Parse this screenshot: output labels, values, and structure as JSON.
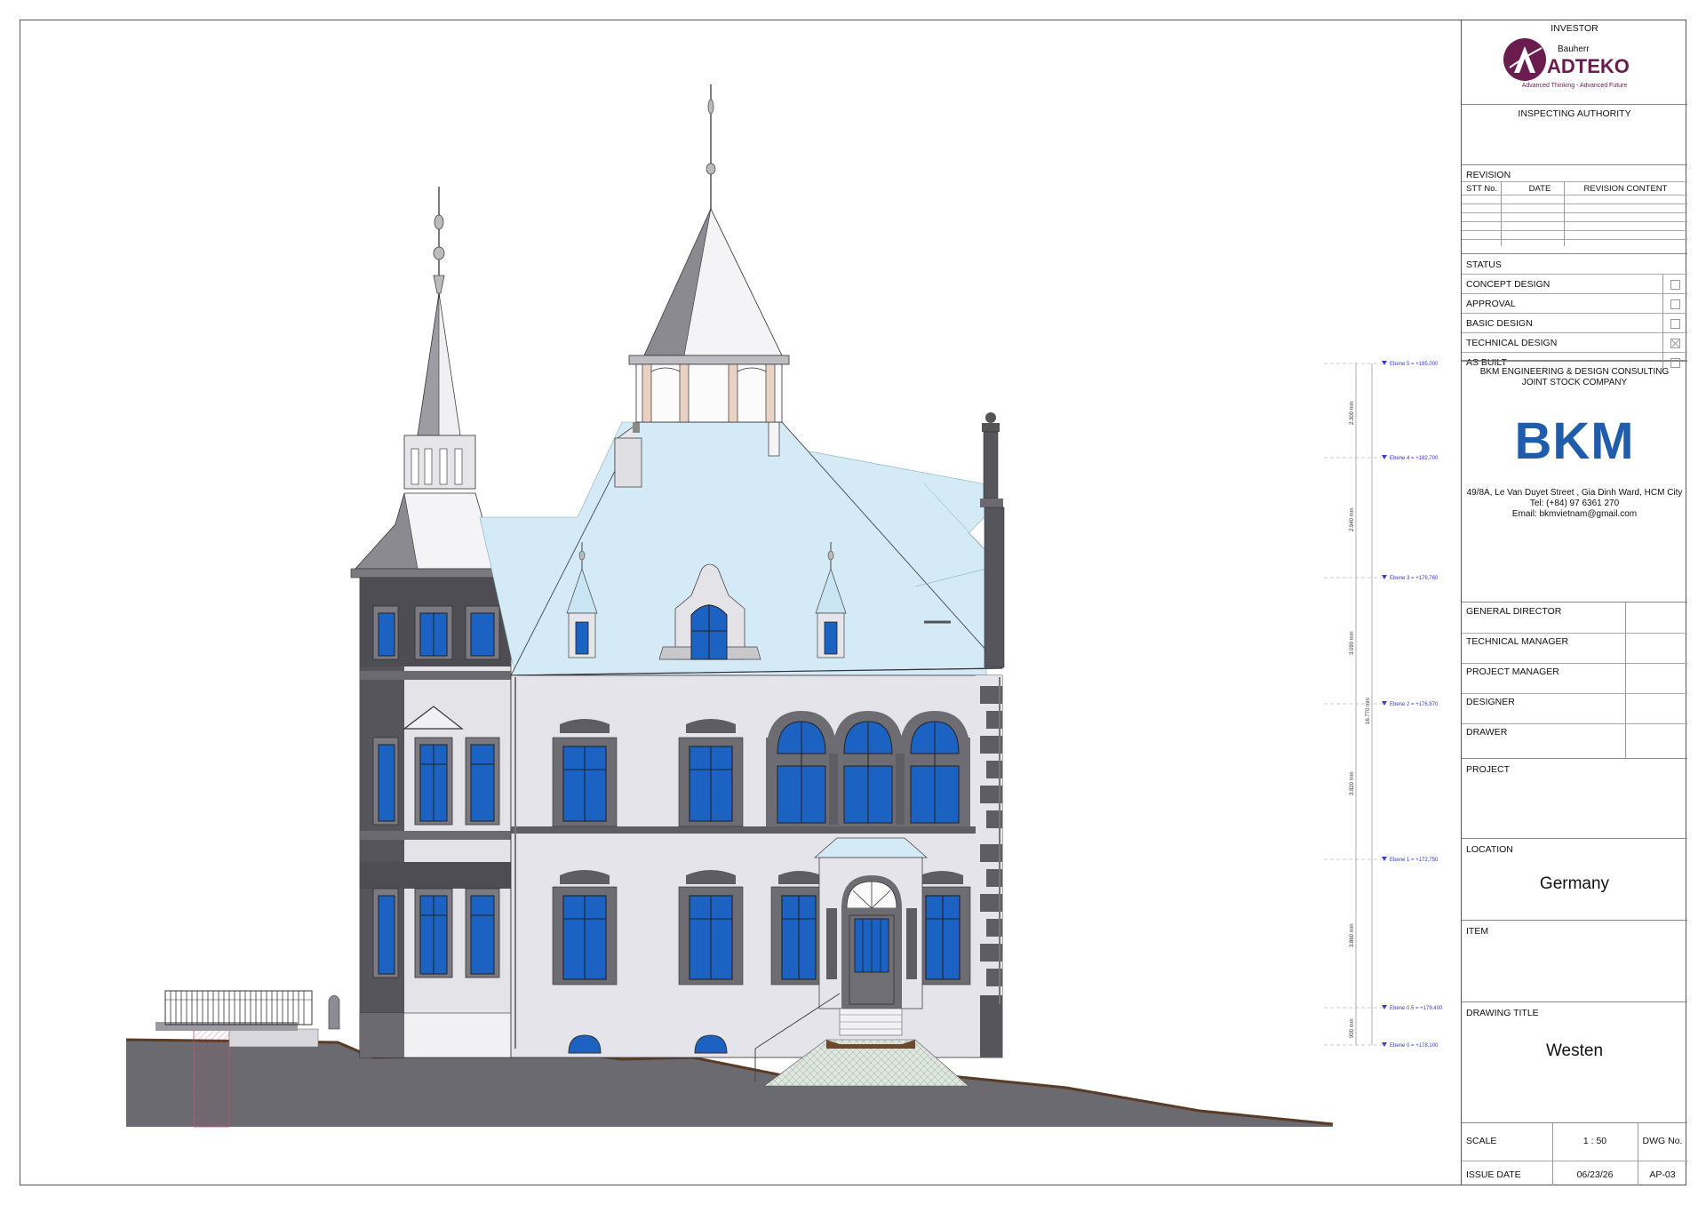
{
  "titleblock": {
    "investor_label": "INVESTOR",
    "investor_sub": "Bauherr",
    "investor_logo_text": "ADTEKO",
    "investor_slogan": "Advanced Thinking - Advanced Future",
    "inspecting_label": "INSPECTING AUTHORITY",
    "revision_label": "REVISION",
    "revision_headers": [
      "STT No.",
      "DATE",
      "REVISION CONTENT"
    ],
    "status_label": "STATUS",
    "status_items": [
      {
        "label": "CONCEPT DESIGN",
        "checked": false
      },
      {
        "label": "APPROVAL",
        "checked": false
      },
      {
        "label": "BASIC DESIGN",
        "checked": false
      },
      {
        "label": "TECHNICAL DESIGN",
        "checked": true
      },
      {
        "label": "AS BUILT",
        "checked": false
      }
    ],
    "company_line1": "BKM ENGINEERING & DESIGN CONSULTING",
    "company_line2": "JOINT STOCK COMPANY",
    "company_logo": "BKM",
    "company_color": "#1f5cab",
    "company_address": "49/8A, Le Van Duyet Street , Gia Dinh Ward, HCM City",
    "company_tel": "Tel: (+84) 97 6361 270",
    "company_email": "Email: bkmvietnam@gmail.com",
    "roles": [
      "GENERAL DIRECTOR",
      "TECHNICAL MANAGER",
      "PROJECT MANAGER",
      "DESIGNER",
      "DRAWER"
    ],
    "project_label": "PROJECT",
    "location_label": "LOCATION",
    "location_value": "Germany",
    "item_label": "ITEM",
    "drawing_title_label": "DRAWING TITLE",
    "drawing_title_value": "Westen",
    "scale_label": "SCALE",
    "scale_value": "1 : 50",
    "dwg_label": "DWG No.",
    "issue_label": "ISSUE DATE",
    "issue_value": "06/23/26",
    "dwg_value": "AP-03"
  },
  "elevation": {
    "levels": [
      "Ebene 5 = +185,000",
      "Ebene 4 = +182,700",
      "Ebene 3 = +179,760",
      "Ebene 2 = +176,870",
      "Ebene 1 = +172,750",
      "Ebene 0.5 = +179,400",
      "Ebene 0 = +178,100"
    ],
    "dims": [
      "2.300 mm",
      "2.940 mm",
      "3.090 mm",
      "3.820 mm",
      "3.860 mm",
      "900 mm"
    ],
    "total_dim": "16.770 mm"
  },
  "colors": {
    "roof": "#d4ebf7",
    "wall": "#e4e4ea",
    "dark": "#5d5d63",
    "glass": "#1c62c2",
    "logo_adteko": "#6b1c4e"
  }
}
